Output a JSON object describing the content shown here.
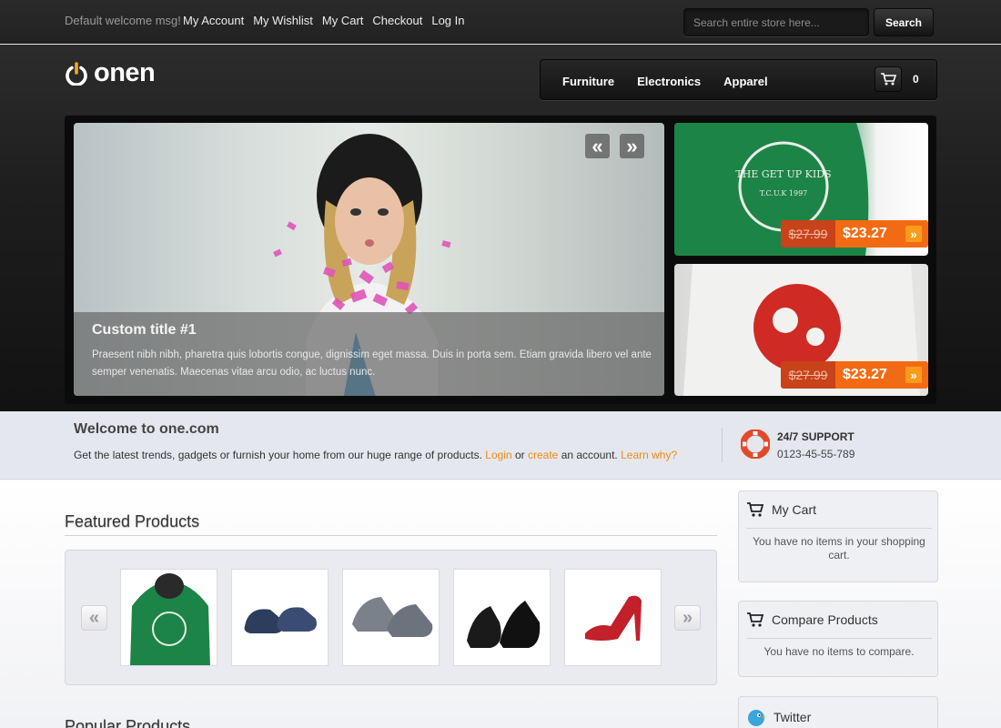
{
  "topbar": {
    "welcome": "Default welcome msg!",
    "links": [
      "My Account",
      "My Wishlist",
      "My Cart",
      "Checkout",
      "Log In"
    ],
    "search_placeholder": "Search entire store here...",
    "search_button": "Search"
  },
  "header": {
    "logo": "onen",
    "nav": [
      "Furniture",
      "Electronics",
      "Apparel"
    ],
    "cart_count": "0"
  },
  "slider": {
    "prev": "«",
    "next": "»",
    "caption_title": "Custom title #1",
    "caption_text": "Praesent nibh nibh, pharetra quis lobortis congue, dignissim eget massa. Duis in porta sem. Etiam gravida libero vel ante semper venenatis. Maecenas vitae arcu odio, ac luctus nunc.",
    "side": [
      {
        "old_price": "$27.99",
        "new_price": "$23.27",
        "arrow": "»"
      },
      {
        "old_price": "$27.99",
        "new_price": "$23.27",
        "arrow": "»"
      }
    ]
  },
  "welcome_band": {
    "title": "Welcome to one.com",
    "text_before": "Get the latest trends, gadgets or furnish your home from our huge range of products.",
    "login": "Login",
    "or": "or",
    "create": "create",
    "after": "an account.",
    "learn": "Learn why?",
    "support_title": "24/7 SUPPORT",
    "support_phone": "0123-45-55-789"
  },
  "featured": {
    "title": "Featured Products",
    "prev": "«",
    "next": "»",
    "products": [
      "green-hoodie",
      "blue-clogs",
      "grey-sneakers",
      "black-loafers",
      "red-heels"
    ]
  },
  "popular": {
    "title": "Popular Products"
  },
  "sidebar": {
    "cart_title": "My Cart",
    "cart_text": "You have no items in your shopping cart.",
    "compare_title": "Compare Products",
    "compare_text": "You have no items to compare.",
    "twitter_title": "Twitter"
  },
  "colors": {
    "accent": "#f08a12",
    "price_new": "#f26b14",
    "price_old": "#c8431a"
  }
}
